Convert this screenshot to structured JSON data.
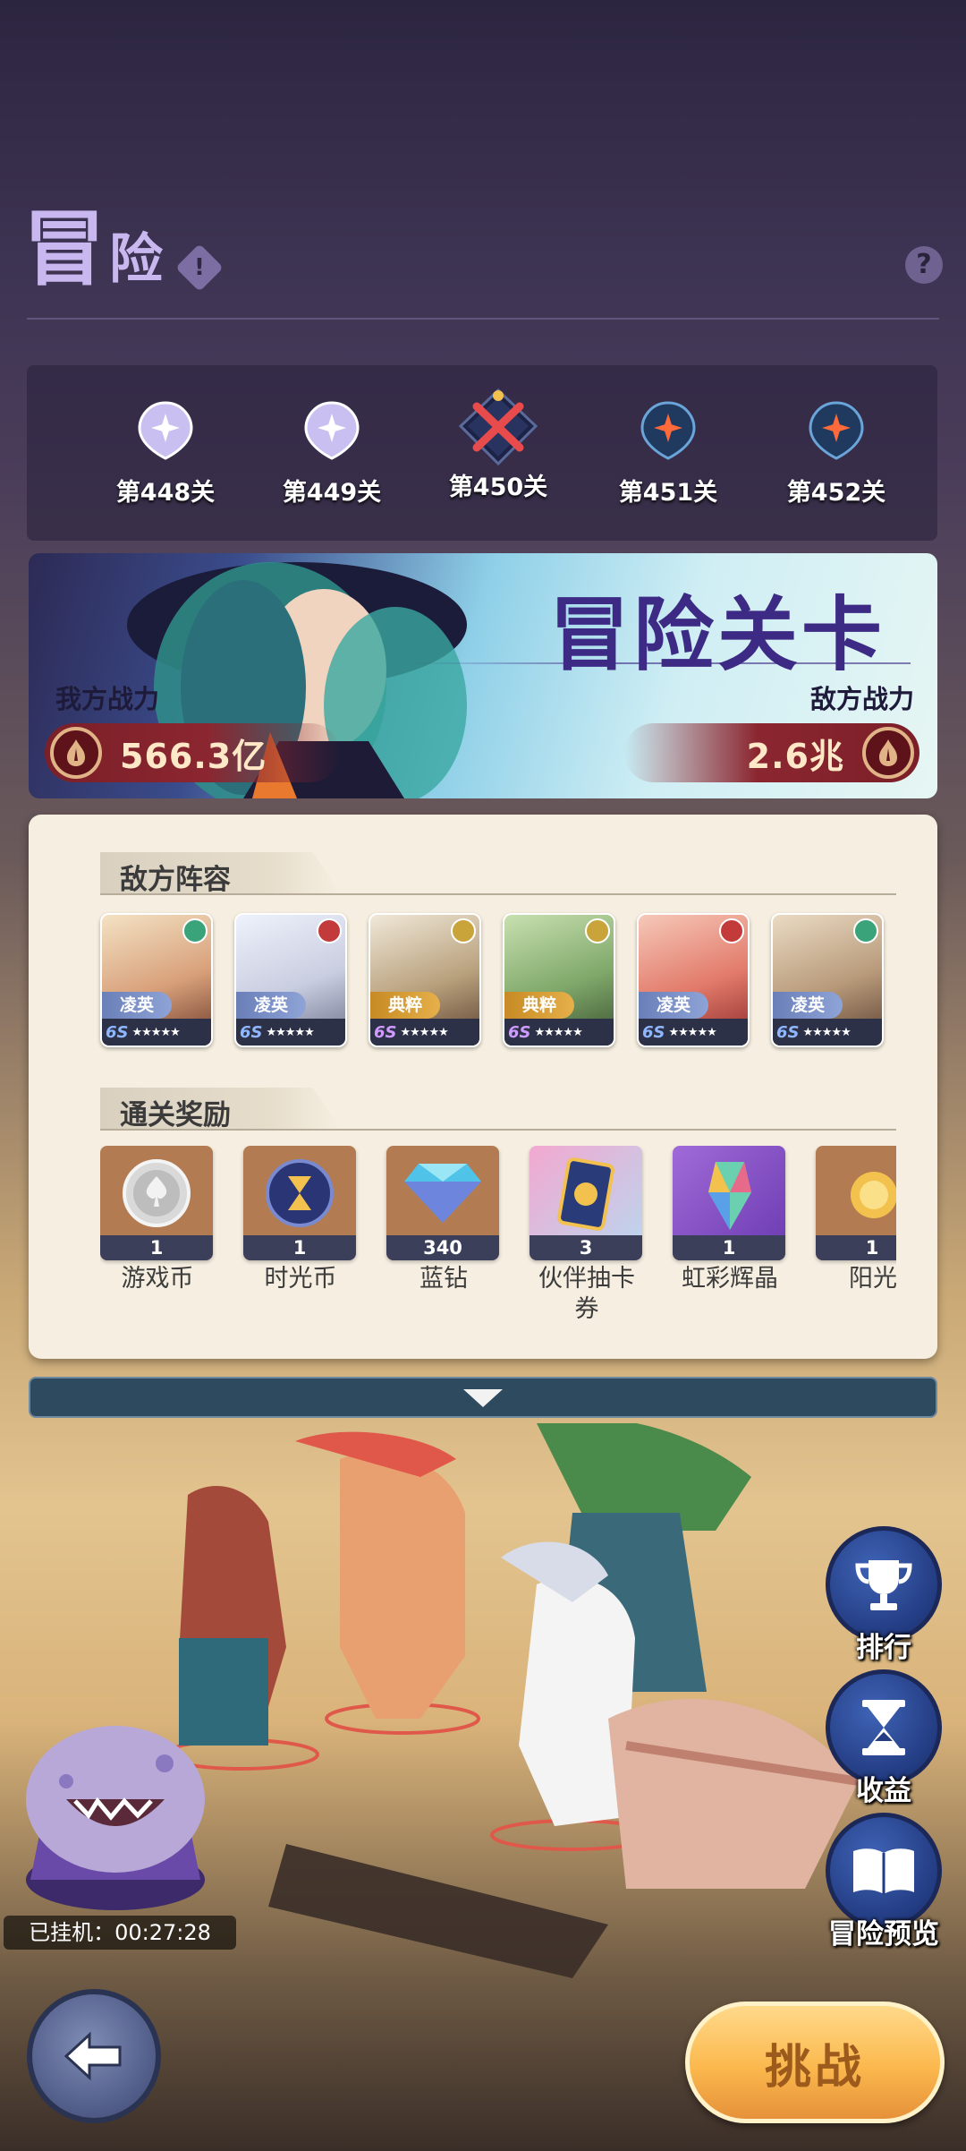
{
  "header": {
    "title_part1": "冒",
    "title_part2": "险",
    "info_icon": "!",
    "help_icon": "?"
  },
  "stages": [
    {
      "label": "第448关",
      "state": "cleared"
    },
    {
      "label": "第449关",
      "state": "cleared"
    },
    {
      "label": "第450关",
      "state": "current"
    },
    {
      "label": "第451关",
      "state": "locked"
    },
    {
      "label": "第452关",
      "state": "locked"
    }
  ],
  "banner": {
    "title": "冒险关卡",
    "my_power_label": "我方战力",
    "my_power_value": "566.3亿",
    "enemy_power_label": "敌方战力",
    "enemy_power_value": "2.6兆"
  },
  "enemy_lineup": {
    "title": "敌方阵容",
    "heroes": [
      {
        "tag": "凌英",
        "level": "6S",
        "stars": "★★★★★",
        "faction_color": "#3aa37a",
        "portrait_color": "#d8a07a"
      },
      {
        "tag": "凌英",
        "level": "6S",
        "stars": "★★★★★",
        "faction_color": "#c23a3a",
        "portrait_color": "#c9cde0"
      },
      {
        "tag": "典粹",
        "level": "6S",
        "stars": "★★★★★",
        "faction_color": "#c9a43a",
        "portrait_color": "#b8a07c"
      },
      {
        "tag": "典粹",
        "level": "6S",
        "stars": "★★★★★",
        "faction_color": "#c9a43a",
        "portrait_color": "#7fa86a"
      },
      {
        "tag": "凌英",
        "level": "6S",
        "stars": "★★★★★",
        "faction_color": "#c23a3a",
        "portrait_color": "#e27a6a"
      },
      {
        "tag": "凌英",
        "level": "6S",
        "stars": "★★★★★",
        "faction_color": "#3aa37a",
        "portrait_color": "#b89a7a"
      }
    ]
  },
  "rewards": {
    "title": "通关奖励",
    "items": [
      {
        "name": "游戏币",
        "count": "1",
        "bg": "#b27b52"
      },
      {
        "name": "时光币",
        "count": "1",
        "bg": "#b27b52"
      },
      {
        "name": "蓝钻",
        "count": "340",
        "bg": "#b27b52"
      },
      {
        "name": "伙伴抽卡券",
        "count": "3",
        "bg": "#e8a0c8"
      },
      {
        "name": "虹彩辉晶",
        "count": "1",
        "bg": "#8a5bc8"
      },
      {
        "name": "阳光",
        "count": "1",
        "bg": "#b27b52"
      }
    ]
  },
  "side_buttons": {
    "rank": "排行",
    "income": "收益",
    "preview": "冒险预览"
  },
  "idle": {
    "text": "已挂机：00:27:28"
  },
  "challenge_label": "挑战",
  "colors": {
    "title": "#c9b8ef",
    "banner_title": "#3c2a84",
    "power_pill": "#8b2630",
    "challenge": "#fbb84d"
  }
}
